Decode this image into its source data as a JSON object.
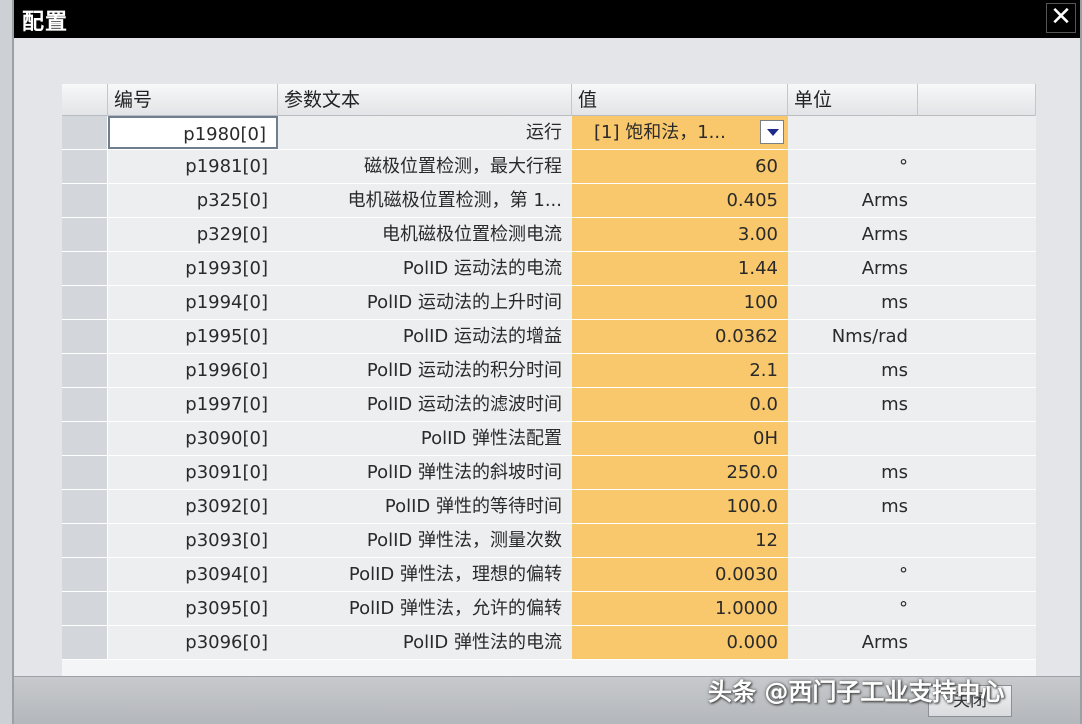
{
  "dialog": {
    "title": "配置",
    "close_label": "✕",
    "ok_label": "关闭"
  },
  "table": {
    "headers": [
      "编号",
      "参数文本",
      "值",
      "单位"
    ],
    "rows": [
      {
        "id": "p1980[0]",
        "text": "运行",
        "value": "[1] 饱和法，1...",
        "unit": ""
      },
      {
        "id": "p1981[0]",
        "text": "磁极位置检测，最大行程",
        "value": "60",
        "unit": "°"
      },
      {
        "id": "p325[0]",
        "text": "电机磁极位置检测，第 1...",
        "value": "0.405",
        "unit": "Arms"
      },
      {
        "id": "p329[0]",
        "text": "电机磁极位置检测电流",
        "value": "3.00",
        "unit": "Arms"
      },
      {
        "id": "p1993[0]",
        "text": "PolID 运动法的电流",
        "value": "1.44",
        "unit": "Arms"
      },
      {
        "id": "p1994[0]",
        "text": "PolID 运动法的上升时间",
        "value": "100",
        "unit": "ms"
      },
      {
        "id": "p1995[0]",
        "text": "PolID 运动法的增益",
        "value": "0.0362",
        "unit": "Nms/rad"
      },
      {
        "id": "p1996[0]",
        "text": "PolID 运动法的积分时间",
        "value": "2.1",
        "unit": "ms"
      },
      {
        "id": "p1997[0]",
        "text": "PolID 运动法的滤波时间",
        "value": "0.0",
        "unit": "ms"
      },
      {
        "id": "p3090[0]",
        "text": "PolID 弹性法配置",
        "value": "0H",
        "unit": ""
      },
      {
        "id": "p3091[0]",
        "text": "PolID 弹性法的斜坡时间",
        "value": "250.0",
        "unit": "ms"
      },
      {
        "id": "p3092[0]",
        "text": "PolID 弹性的等待时间",
        "value": "100.0",
        "unit": "ms"
      },
      {
        "id": "p3093[0]",
        "text": "PolID 弹性法，测量次数",
        "value": "12",
        "unit": ""
      },
      {
        "id": "p3094[0]",
        "text": "PolID 弹性法，理想的偏转",
        "value": "0.0030",
        "unit": "°"
      },
      {
        "id": "p3095[0]",
        "text": "PolID 弹性法，允许的偏转",
        "value": "1.0000",
        "unit": "°"
      },
      {
        "id": "p3096[0]",
        "text": "PolID 弹性法的电流",
        "value": "0.000",
        "unit": "Arms"
      }
    ]
  },
  "watermark": "头条 @西门子工业支持中心",
  "colors": {
    "value_cell": "#f9c86c",
    "titlebar": "#000000"
  }
}
